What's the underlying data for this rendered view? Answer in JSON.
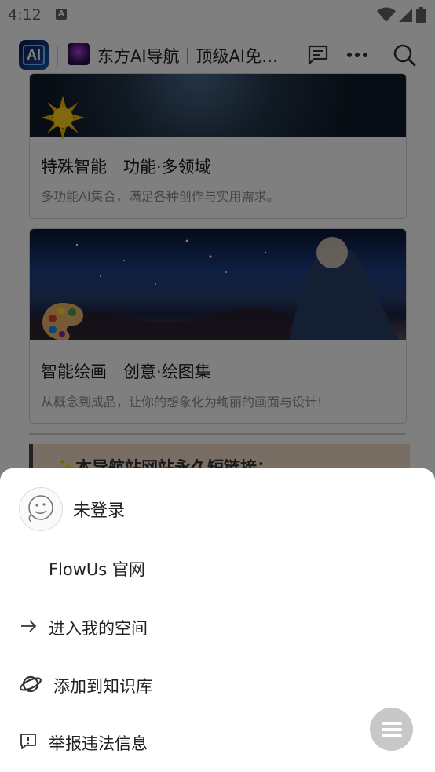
{
  "status_bar": {
    "time": "4:12",
    "notification_icon": "a-icon",
    "system_icons": [
      "wifi-icon",
      "signal-icon",
      "battery-icon"
    ]
  },
  "header": {
    "app_icon_text": "AI",
    "site_icon": "site-logo",
    "title": "东方AI导航｜顶级AI免…",
    "actions": [
      "comment-icon",
      "more-icon",
      "search-icon"
    ]
  },
  "cards": [
    {
      "title": "特殊智能｜功能·多领域",
      "description": "多功能AI集合，满足各种创作与实用需求。",
      "emoji_icon": "sun-icon"
    },
    {
      "title": "智能绘画｜创意·绘图集",
      "description": "从概念到成品，让你的想象化为绚丽的画面与设计!",
      "emoji_icon": "palette-icon"
    }
  ],
  "callout": {
    "text": "✨本导航站网站永久短链接："
  },
  "sheet": {
    "user_status": "未登录",
    "menu": [
      {
        "label": "FlowUs 官网",
        "icon": ""
      },
      {
        "label": "进入我的空间",
        "icon": "arrow-right-icon"
      },
      {
        "label": "添加到知识库",
        "icon": "planet-icon"
      },
      {
        "label": "举报违法信息",
        "icon": "report-icon"
      }
    ],
    "fab_icon": "menu-lines-icon"
  },
  "colors": {
    "overlay": "#000000",
    "callout_bg": "#f3dcc6",
    "app_icon_bg": "#1f4fb0"
  }
}
